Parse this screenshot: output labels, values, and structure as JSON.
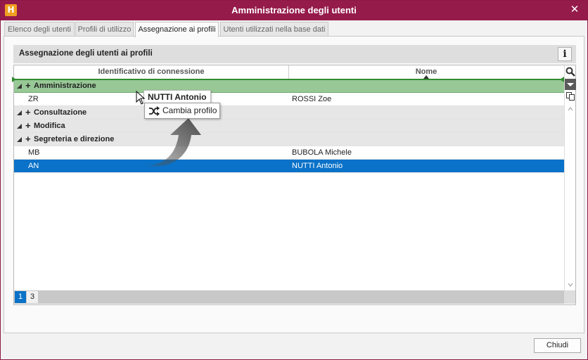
{
  "window": {
    "title": "Amministrazione degli utenti",
    "app_icon_letter": "H",
    "accent_color": "#951b4b"
  },
  "tabs": [
    {
      "label": "Elenco degli utenti",
      "active": false
    },
    {
      "label": "Profili di utilizzo",
      "active": false
    },
    {
      "label": "Assegnazione ai profili",
      "active": true
    },
    {
      "label": "Utenti utilizzati nella base dati",
      "active": false
    }
  ],
  "section": {
    "title": "Assegnazione degli utenti ai profili",
    "info_icon": "info-icon"
  },
  "grid": {
    "columns": [
      "Identificativo di connessione",
      "Nome"
    ],
    "sort_column": "Nome",
    "groups": [
      {
        "label": "Amministrazione",
        "highlight": true,
        "rows": [
          {
            "id": "ZR",
            "name": "ROSSI Zoe"
          }
        ]
      },
      {
        "label": "Consultazione",
        "rows": []
      },
      {
        "label": "Modifica",
        "rows": []
      },
      {
        "label": "Segreteria e direzione",
        "rows": [
          {
            "id": "MB",
            "name": "BUBOLA Michele"
          },
          {
            "id": "AN",
            "name": "NUTTI Antonio",
            "selected": true
          }
        ]
      }
    ]
  },
  "pager": {
    "pages": [
      "1",
      "3"
    ],
    "current": "1"
  },
  "drag_tooltip": {
    "user_name": "NUTTI Antonio",
    "action_label": "Cambia profilo"
  },
  "footer": {
    "close_label": "Chiudi"
  },
  "colors": {
    "selection": "#0a72c8",
    "drop_target": "#98c896",
    "drop_line": "#2f8c2f"
  }
}
